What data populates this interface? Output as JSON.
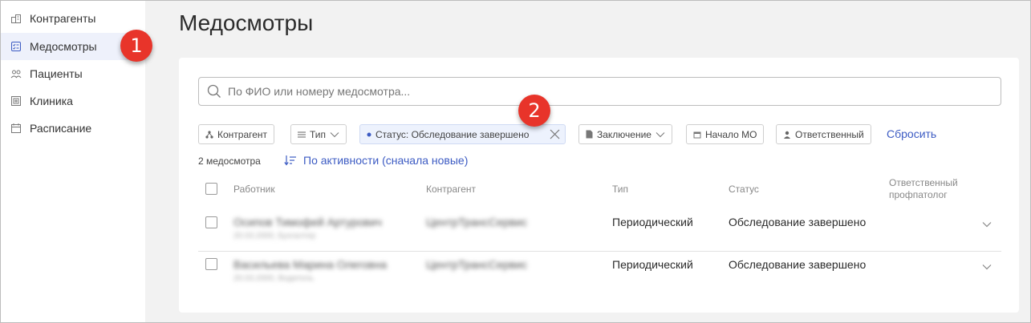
{
  "sidebar": {
    "items": [
      {
        "label": "Контрагенты",
        "icon": "building-icon",
        "active": false
      },
      {
        "label": "Медосмотры",
        "icon": "checklist-icon",
        "active": true
      },
      {
        "label": "Пациенты",
        "icon": "people-icon",
        "active": false
      },
      {
        "label": "Клиника",
        "icon": "hospital-icon",
        "active": false
      },
      {
        "label": "Расписание",
        "icon": "calendar-icon",
        "active": false
      }
    ]
  },
  "page": {
    "title": "Медосмотры"
  },
  "search": {
    "placeholder": "По ФИО или номеру медосмотра..."
  },
  "filters": [
    {
      "label": "Контрагент",
      "icon": "org-icon"
    },
    {
      "label": "Тип",
      "icon": "list-icon",
      "dropdown": true
    },
    {
      "label": "Статус: Обследование завершено",
      "icon": "dot-icon",
      "active": true,
      "removable": true
    },
    {
      "label": "Заключение",
      "icon": "document-icon",
      "dropdown": true
    },
    {
      "label": "Начало МО",
      "icon": "calendar-icon"
    },
    {
      "label": "Ответственный",
      "icon": "person-icon"
    }
  ],
  "reset_label": "Сбросить",
  "results": {
    "count": "2 медосмотра",
    "sort_label": "По активности (сначала новые)"
  },
  "table": {
    "headers": {
      "worker": "Работник",
      "contractor": "Контрагент",
      "type": "Тип",
      "status": "Статус",
      "responsible_line1": "Ответственный",
      "responsible_line2": "профпатолог"
    },
    "rows": [
      {
        "worker_name": "Осипов Тимофей Артурович",
        "worker_sub": "20.03.2000, Бухгалтер",
        "contractor": "ЦентрТрансСервис",
        "type": "Периодический",
        "status": "Обследование завершено"
      },
      {
        "worker_name": "Васильева Марина Олеговна",
        "worker_sub": "20.03.2000, Водитель",
        "contractor": "ЦентрТрансСервис",
        "type": "Периодический",
        "status": "Обследование завершено"
      }
    ]
  },
  "annotations": {
    "badge1": "1",
    "badge2": "2"
  },
  "colors": {
    "accent": "#3c5bc3",
    "badge": "#e8342a",
    "active_chip": "#edf2fd"
  }
}
